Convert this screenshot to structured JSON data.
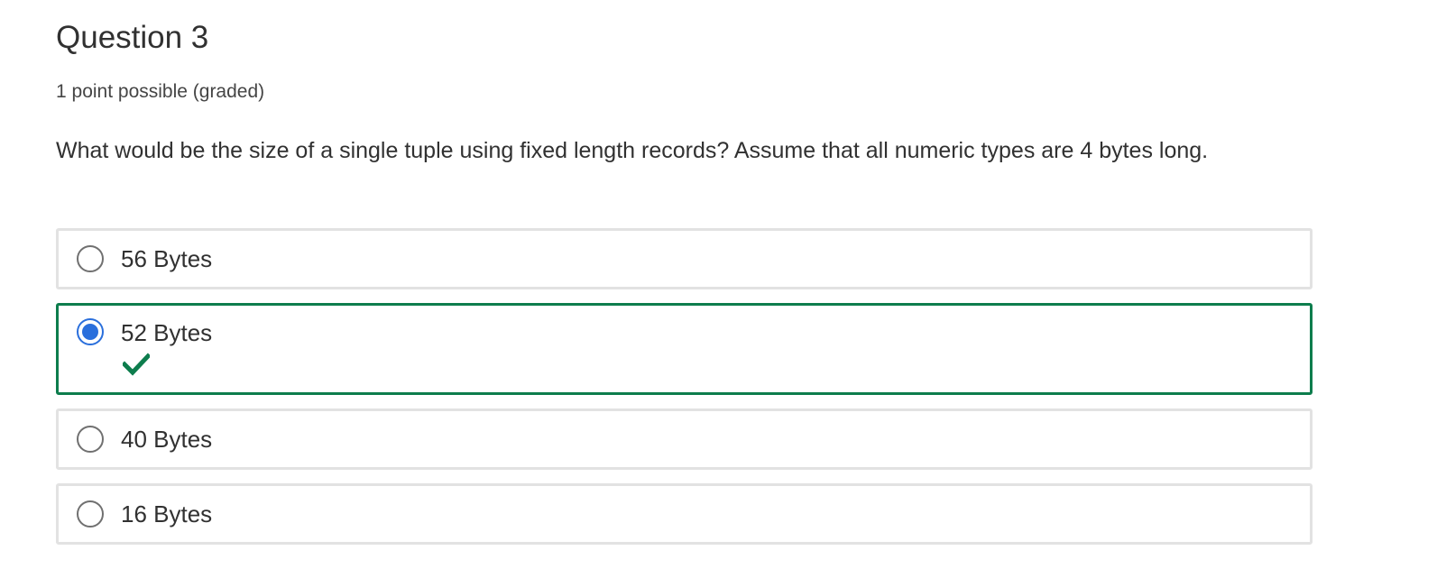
{
  "problem": {
    "title": "Question 3",
    "points": "1 point possible (graded)",
    "prompt": "What would be the size of a single tuple using fixed length records? Assume that all numeric types are 4 bytes long."
  },
  "choices": [
    {
      "label": "56 Bytes",
      "selected": false,
      "status": "none"
    },
    {
      "label": "52 Bytes",
      "selected": true,
      "status": "correct"
    },
    {
      "label": "40 Bytes",
      "selected": false,
      "status": "none"
    },
    {
      "label": "16 Bytes",
      "selected": false,
      "status": "none"
    }
  ],
  "colors": {
    "correct": "#0d7d4d",
    "selected_radio": "#2a6fdc",
    "border": "#e2e2e2",
    "text": "#313131"
  },
  "icons": {
    "correct_indicator": "check-icon"
  }
}
